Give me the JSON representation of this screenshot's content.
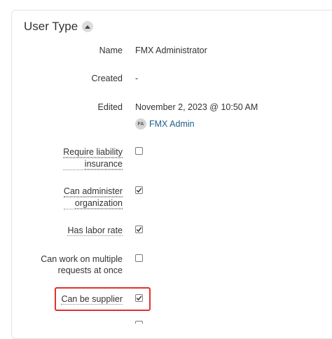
{
  "section": {
    "title": "User Type",
    "collapse_icon": "chevron-up-icon"
  },
  "fields": {
    "name": {
      "label": "Name",
      "value": "FMX Administrator"
    },
    "created": {
      "label": "Created",
      "value": "-"
    },
    "edited": {
      "label": "Edited",
      "value": "November 2, 2023 @ 10:50 AM",
      "user_initials": "FA",
      "user_name": "FMX Admin"
    }
  },
  "permissions": {
    "require_liability_insurance": {
      "label_line1": "Require liability",
      "label_line2": "insurance",
      "checked": false
    },
    "can_administer_organization": {
      "label_line1": "Can administer",
      "label_line2": "organization",
      "checked": true
    },
    "has_labor_rate": {
      "label": "Has labor rate",
      "checked": true
    },
    "can_work_on_multiple_requests": {
      "label_line1": "Can work on multiple",
      "label_line2": "requests at once",
      "checked": false
    },
    "can_be_supplier": {
      "label": "Can be supplier",
      "checked": true
    }
  },
  "colors": {
    "accent_link": "#1f5f86",
    "highlight_border": "#e03131"
  }
}
